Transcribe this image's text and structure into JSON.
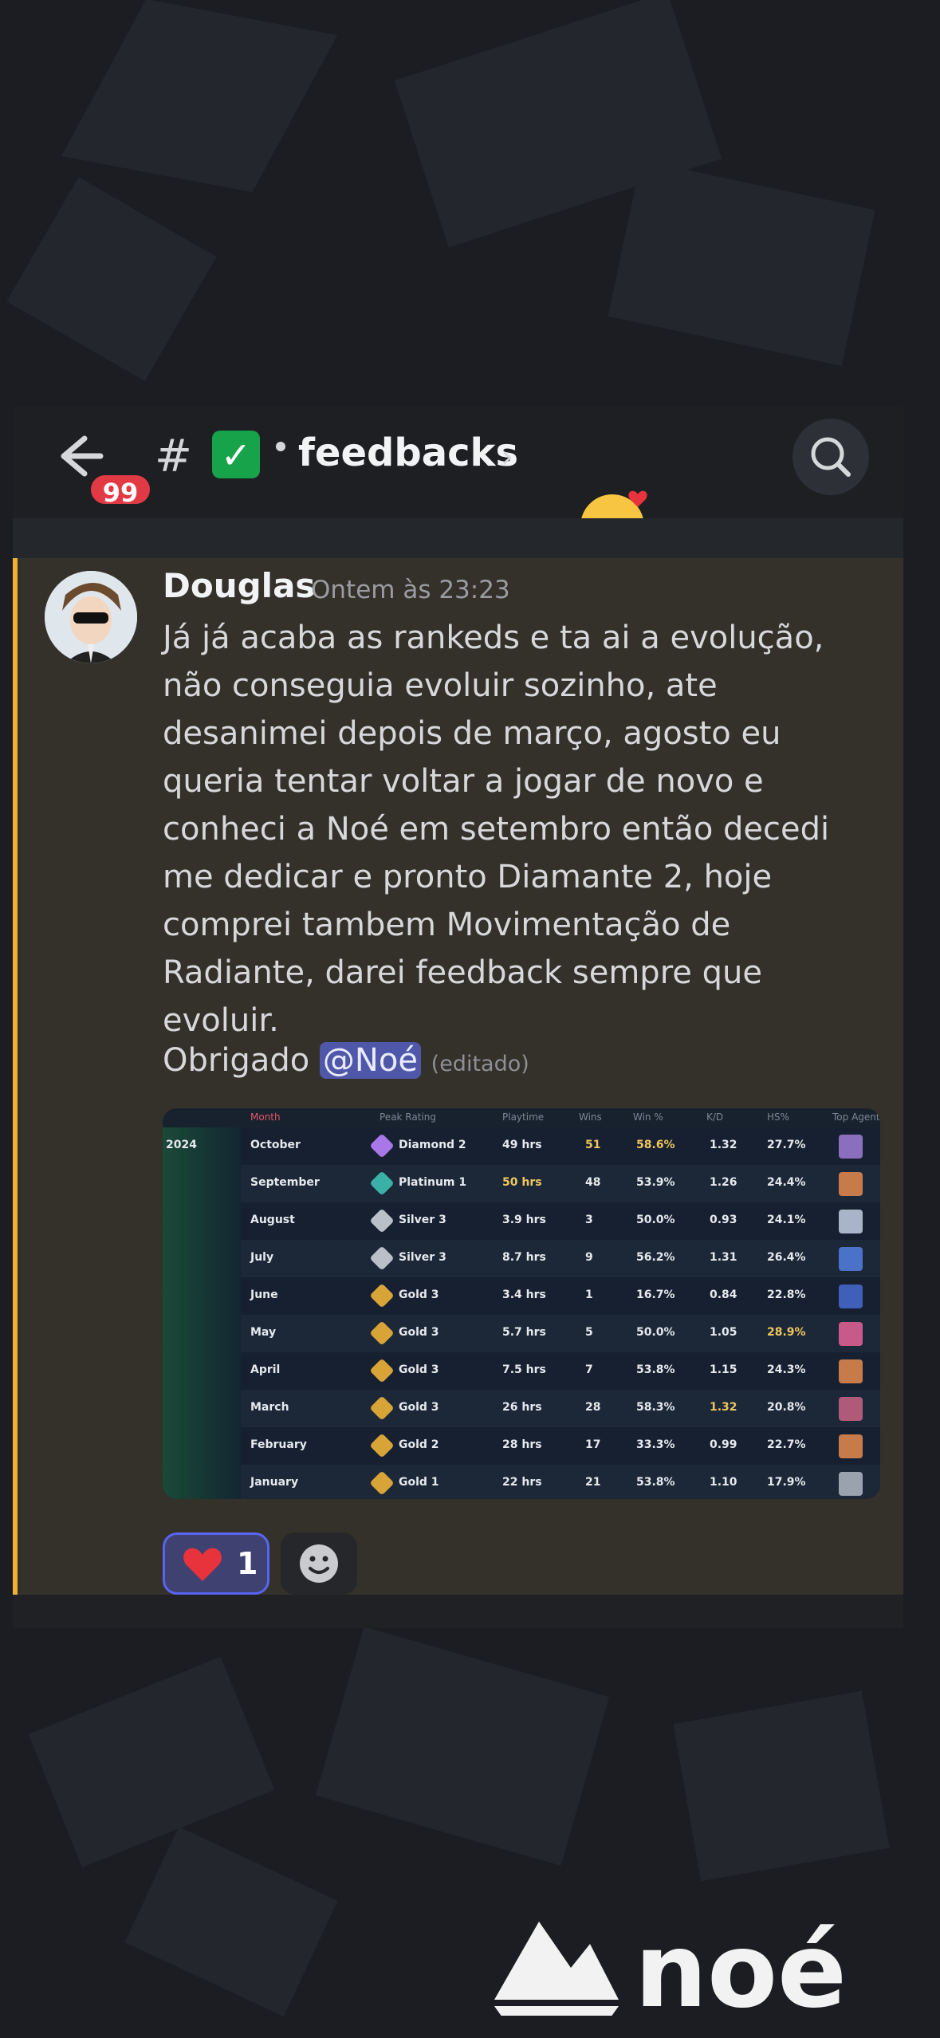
{
  "header": {
    "unread_count": "99",
    "hash": "#",
    "check_glyph": "✓",
    "channel_name": "feedbacks",
    "chevron": "›"
  },
  "message": {
    "author": "Douglas",
    "timestamp": "Ontem às 23:23",
    "body": "Já já acaba as rankeds e ta ai a evolução, não conseguia evoluir sozinho, ate desanimei depois de março, agosto eu queria tentar voltar a jogar de novo e conheci a Noé em setembro então decedi me dedicar e pronto Diamante 2, hoje comprei tambem Movimentação de Radiante, darei feedback sempre que evoluir.",
    "thanks": "Obrigado",
    "mention": "@Noé",
    "edited": "(editado)"
  },
  "stats_table": {
    "columns": [
      "Month",
      "Peak Rating",
      "Playtime",
      "Wins",
      "Win %",
      "K/D",
      "HS%",
      "Top Agent"
    ],
    "year": "2024",
    "rows": [
      {
        "month": "October",
        "rating": "Diamond 2",
        "playtime": "49 hrs",
        "wins": "51",
        "winp": "58.6%",
        "kd": "1.32",
        "hs": "27.7%"
      },
      {
        "month": "September",
        "rating": "Platinum 1",
        "playtime": "50 hrs",
        "wins": "48",
        "winp": "53.9%",
        "kd": "1.26",
        "hs": "24.4%"
      },
      {
        "month": "August",
        "rating": "Silver 3",
        "playtime": "3.9 hrs",
        "wins": "3",
        "winp": "50.0%",
        "kd": "0.93",
        "hs": "24.1%"
      },
      {
        "month": "July",
        "rating": "Silver 3",
        "playtime": "8.7 hrs",
        "wins": "9",
        "winp": "56.2%",
        "kd": "1.31",
        "hs": "26.4%"
      },
      {
        "month": "June",
        "rating": "Gold 3",
        "playtime": "3.4 hrs",
        "wins": "1",
        "winp": "16.7%",
        "kd": "0.84",
        "hs": "22.8%"
      },
      {
        "month": "May",
        "rating": "Gold 3",
        "playtime": "5.7 hrs",
        "wins": "5",
        "winp": "50.0%",
        "kd": "1.05",
        "hs": "28.9%"
      },
      {
        "month": "April",
        "rating": "Gold 3",
        "playtime": "7.5 hrs",
        "wins": "7",
        "winp": "53.8%",
        "kd": "1.15",
        "hs": "24.3%"
      },
      {
        "month": "March",
        "rating": "Gold 3",
        "playtime": "26 hrs",
        "wins": "28",
        "winp": "58.3%",
        "kd": "1.32",
        "hs": "20.8%"
      },
      {
        "month": "February",
        "rating": "Gold 2",
        "playtime": "28 hrs",
        "wins": "17",
        "winp": "33.3%",
        "kd": "0.99",
        "hs": "22.7%"
      },
      {
        "month": "January",
        "rating": "Gold 1",
        "playtime": "22 hrs",
        "wins": "21",
        "winp": "53.8%",
        "kd": "1.10",
        "hs": "17.9%"
      }
    ]
  },
  "reactions": [
    {
      "emoji": "heart",
      "count": "1"
    }
  ],
  "brand": {
    "logo_text": "noé"
  },
  "colors": {
    "accent_bar": "#f0b232",
    "mention_bg": "#4f58a8",
    "badge": "#e23a45",
    "highlight": "#f0c75e",
    "diamond": "#a977e8",
    "platinum": "#3bb0a7",
    "silver": "#b9c0c8",
    "gold": "#d8a437"
  }
}
